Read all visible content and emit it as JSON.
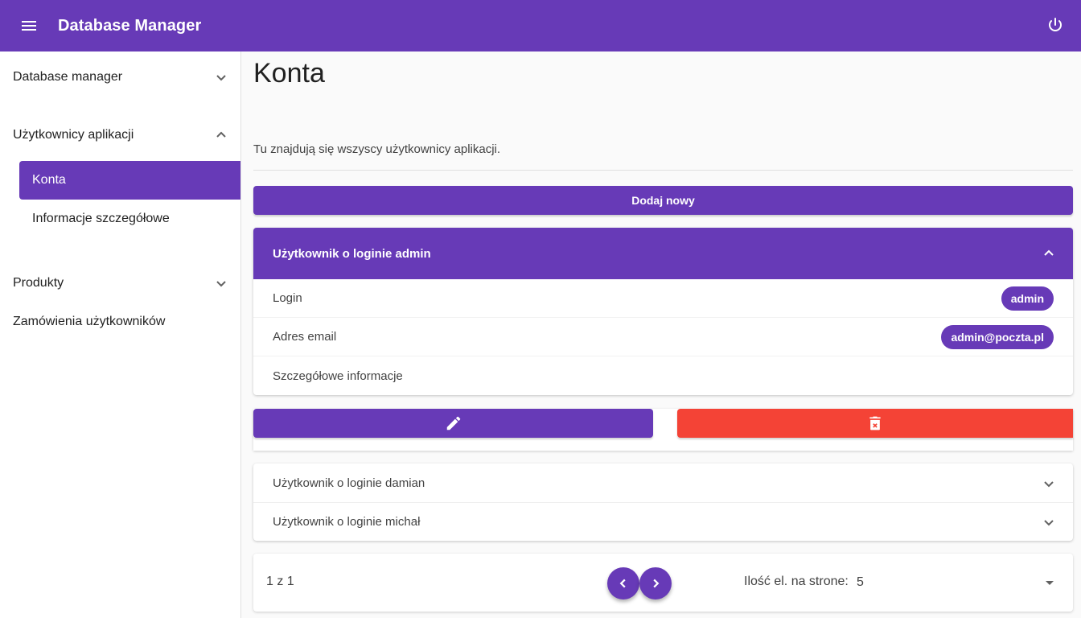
{
  "appbar": {
    "title": "Database Manager",
    "menu_icon": "menu-icon",
    "power_icon": "power-icon",
    "accent_color": "#673ab7"
  },
  "sidebar": {
    "groups": [
      {
        "label": "Database manager",
        "expanded": false
      },
      {
        "label": "Użytkownicy aplikacji",
        "expanded": true,
        "items": [
          {
            "label": "Konta",
            "active": true
          },
          {
            "label": "Informacje szczegółowe",
            "active": false
          }
        ]
      },
      {
        "label": "Produkty",
        "expanded": false
      },
      {
        "label": "Zamówienia użytkowników"
      }
    ]
  },
  "main": {
    "title": "Konta",
    "description": "Tu znajdują się wszyscy użytkownicy aplikacji.",
    "add_button": "Dodaj nowy",
    "users": [
      {
        "header": "Użytkownik o loginie admin",
        "expanded": true,
        "fields": [
          {
            "label": "Login",
            "value": "admin"
          },
          {
            "label": "Adres email",
            "value": "admin@poczta.pl"
          },
          {
            "label": "Szczegółowe informacje",
            "value": ""
          }
        ],
        "edit_icon": "pencil-icon",
        "delete_icon": "trash-icon",
        "delete_color": "#f44336"
      },
      {
        "header": "Użytkownik o loginie damian",
        "expanded": false
      },
      {
        "header": "Użytkownik o loginie michał",
        "expanded": false
      }
    ],
    "pagination": {
      "page_info": "1 z 1",
      "per_page_label": "Ilość el. na strone:",
      "per_page_value": "5"
    }
  }
}
